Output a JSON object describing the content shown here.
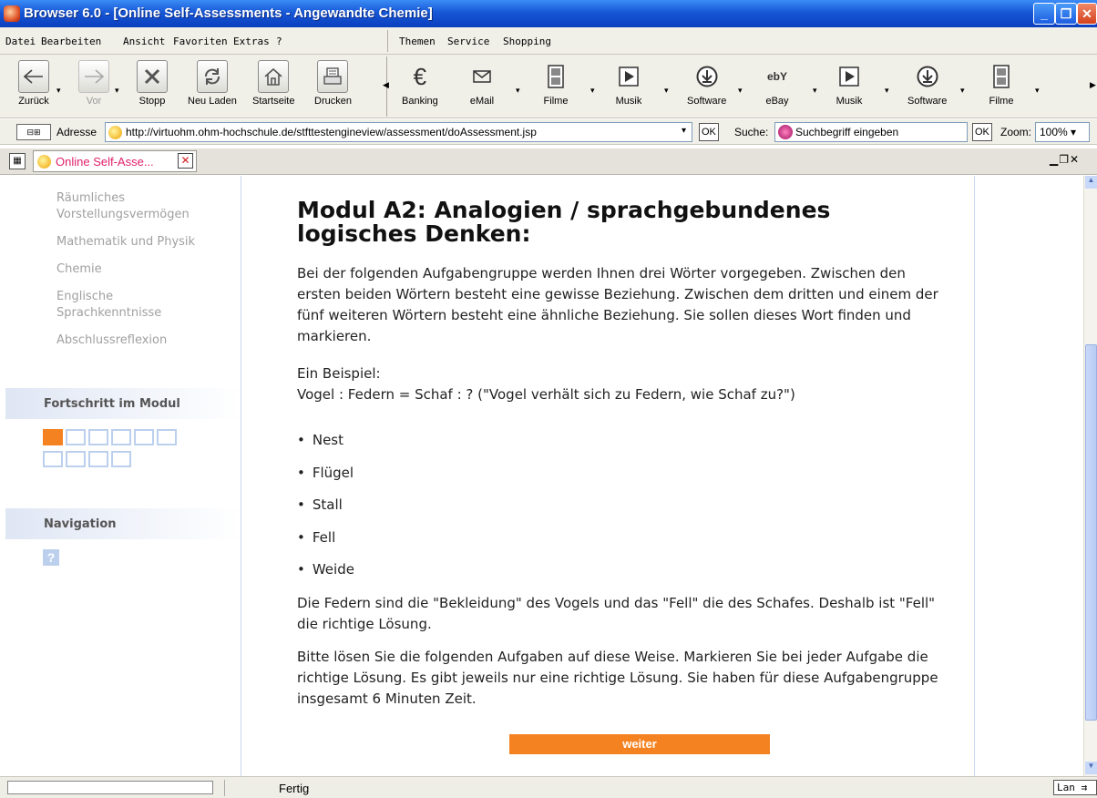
{
  "window": {
    "title": "Browser 6.0 - [Online Self-Assessments - Angewandte Chemie]"
  },
  "menu": {
    "left": [
      "Datei",
      "Bearbeiten",
      "Ansicht",
      "Favoriten",
      "Extras",
      "?"
    ],
    "right": [
      "Themen",
      "Service",
      "Shopping"
    ]
  },
  "toolbar": {
    "nav": [
      {
        "label": "Zurück",
        "icon": "arrow-left-icon"
      },
      {
        "label": "Vor",
        "icon": "arrow-right-icon"
      },
      {
        "label": "Stopp",
        "icon": "stop-icon"
      },
      {
        "label": "Neu Laden",
        "icon": "reload-icon"
      },
      {
        "label": "Startseite",
        "icon": "home-icon"
      },
      {
        "label": "Drucken",
        "icon": "print-icon"
      }
    ],
    "links": [
      {
        "label": "Banking",
        "icon": "euro-icon"
      },
      {
        "label": "eMail",
        "icon": "mail-icon"
      },
      {
        "label": "Filme",
        "icon": "film-icon"
      },
      {
        "label": "Musik",
        "icon": "play-icon"
      },
      {
        "label": "Software",
        "icon": "download-icon"
      },
      {
        "label": "eBay",
        "icon": "ebay-icon",
        "glyph": "ebY"
      },
      {
        "label": "Musik",
        "icon": "play-icon"
      },
      {
        "label": "Software",
        "icon": "download-icon"
      },
      {
        "label": "Filme",
        "icon": "film-icon"
      }
    ]
  },
  "address": {
    "label": "Adresse",
    "url": "http://virtuohm.ohm-hochschule.de/stfttestengineview/assessment/doAssessment.jsp",
    "ok": "OK",
    "search_label": "Suche:",
    "search_placeholder": "Suchbegriff eingeben",
    "zoom_label": "Zoom:",
    "zoom_value": "100%"
  },
  "tab": {
    "label": "Online Self-Asse..."
  },
  "sidebar": {
    "items": [
      "Räumliches Vorstellungsvermögen",
      "Mathematik und Physik",
      "Chemie",
      "Englische Sprachkenntnisse",
      "Abschlussreflexion"
    ],
    "progress_title": "Fortschritt im Modul",
    "progress": {
      "done": 1,
      "total": 10
    },
    "navigation_title": "Navigation",
    "help_glyph": "?"
  },
  "main": {
    "title": "Modul A2: Analogien / sprachgebundenes logisches Denken:",
    "intro": "Bei der folgenden Aufgabengruppe werden Ihnen drei Wörter vorgegeben. Zwischen den ersten beiden Wörtern besteht eine gewisse Beziehung. Zwischen dem dritten und einem der fünf weiteren Wörtern besteht eine ähnliche Beziehung. Sie sollen dieses Wort finden und markieren.",
    "example_label": "Ein Beispiel:",
    "example": "Vogel : Federn = Schaf : ? (\"Vogel verhält sich zu Federn, wie Schaf zu?\")",
    "options": [
      "Nest",
      "Flügel",
      "Stall",
      "Fell",
      "Weide"
    ],
    "explanation": "Die Federn sind die \"Bekleidung\" des Vogels und das \"Fell\" die des Schafes. Deshalb ist \"Fell\" die richtige Lösung.",
    "instruction": "Bitte lösen Sie die folgenden Aufgaben auf diese Weise. Markieren Sie bei jeder Aufgabe die richtige Lösung. Es gibt jeweils nur eine richtige Lösung. Sie haben für diese Aufgabengruppe insgesamt 6 Minuten Zeit.",
    "next_button": "weiter"
  },
  "status": {
    "text": "Fertig",
    "right": "Lan"
  },
  "colors": {
    "accent": "#f58220",
    "sidebar_band": "#dfe6f4",
    "progress_empty": "#bcd0ee"
  }
}
